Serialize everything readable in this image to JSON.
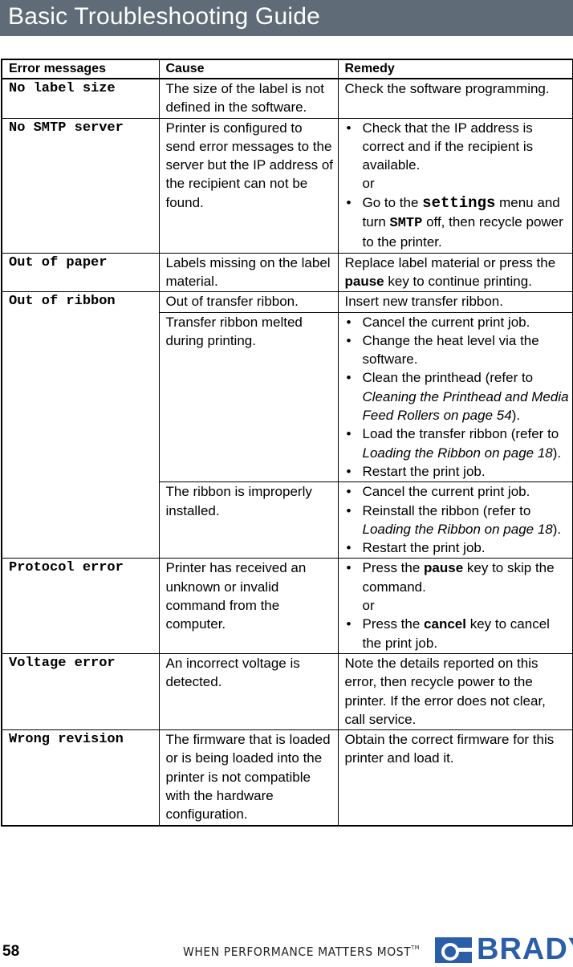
{
  "header": {
    "title": "Basic Troubleshooting Guide"
  },
  "table": {
    "columns": [
      "Error messages",
      "Cause",
      "Remedy"
    ],
    "rows": [
      {
        "error": "No label size",
        "cause": "The size of the label is not defined in the software.",
        "remedy": "Check the software programming."
      },
      {
        "error": "No SMTP server",
        "cause": "Printer is configured to send error messages to the server but the IP address of the recipient can not be found.",
        "remedy_items": {
          "a": "Check that the IP address is correct and if the recipient is available.",
          "or": "or",
          "b_pre": "Go to the ",
          "b_code": "settings",
          "b_mid": " menu and turn ",
          "b_code2": "SMTP",
          "b_post": " off, then recycle power to the printer."
        }
      },
      {
        "error": "Out of paper",
        "cause": "Labels missing on the label material.",
        "remedy_pre": "Replace label material or press the ",
        "remedy_key": "pause",
        "remedy_post": " key to continue printing."
      },
      {
        "error": "Out of ribbon",
        "sub": [
          {
            "cause": "Out of transfer ribbon.",
            "remedy": "Insert new transfer ribbon."
          },
          {
            "cause": "Transfer ribbon melted during printing.",
            "remedy_items": {
              "a": "Cancel the current print job.",
              "b": "Change the heat level via the software.",
              "c_pre": "Clean the printhead (refer to ",
              "c_ref": "Cleaning the Printhead and Media Feed Rollers on page 54",
              "c_post": ").",
              "d_pre": "Load the transfer ribbon (refer to ",
              "d_ref": "Loading the Ribbon on page 18",
              "d_post": ").",
              "e": "Restart the print job."
            }
          },
          {
            "cause": "The ribbon is improperly installed.",
            "remedy_items": {
              "a": "Cancel the current print job.",
              "b_pre": "Reinstall the ribbon (refer to ",
              "b_ref": "Loading the Ribbon on page 18",
              "b_post": ").",
              "c": "Restart the print job."
            }
          }
        ]
      },
      {
        "error": "Protocol error",
        "cause": "Printer has received an unknown or invalid command from the computer.",
        "remedy_items": {
          "a_pre": "Press the ",
          "a_key": "pause",
          "a_post": " key to skip the command.",
          "or": "or",
          "b_pre": "Press the ",
          "b_key": "cancel",
          "b_post": " key to cancel the print job."
        }
      },
      {
        "error": "Voltage error",
        "cause": "An incorrect voltage is detected.",
        "remedy": "Note the details reported on this error, then recycle power to the printer. If the error does not clear, call service."
      },
      {
        "error": "Wrong revision",
        "cause": "The firmware that is loaded or is being loaded into the printer is not compatible with the hardware configuration.",
        "remedy": "Obtain the correct firmware for this printer and load it."
      }
    ]
  },
  "footer": {
    "page_number": "58",
    "tagline": "WHEN PERFORMANCE MATTERS MOST",
    "trademark": "TM",
    "brand": "BRADY",
    "brand_color": "#2a5ea8",
    "header_color": "#5f6b76"
  }
}
